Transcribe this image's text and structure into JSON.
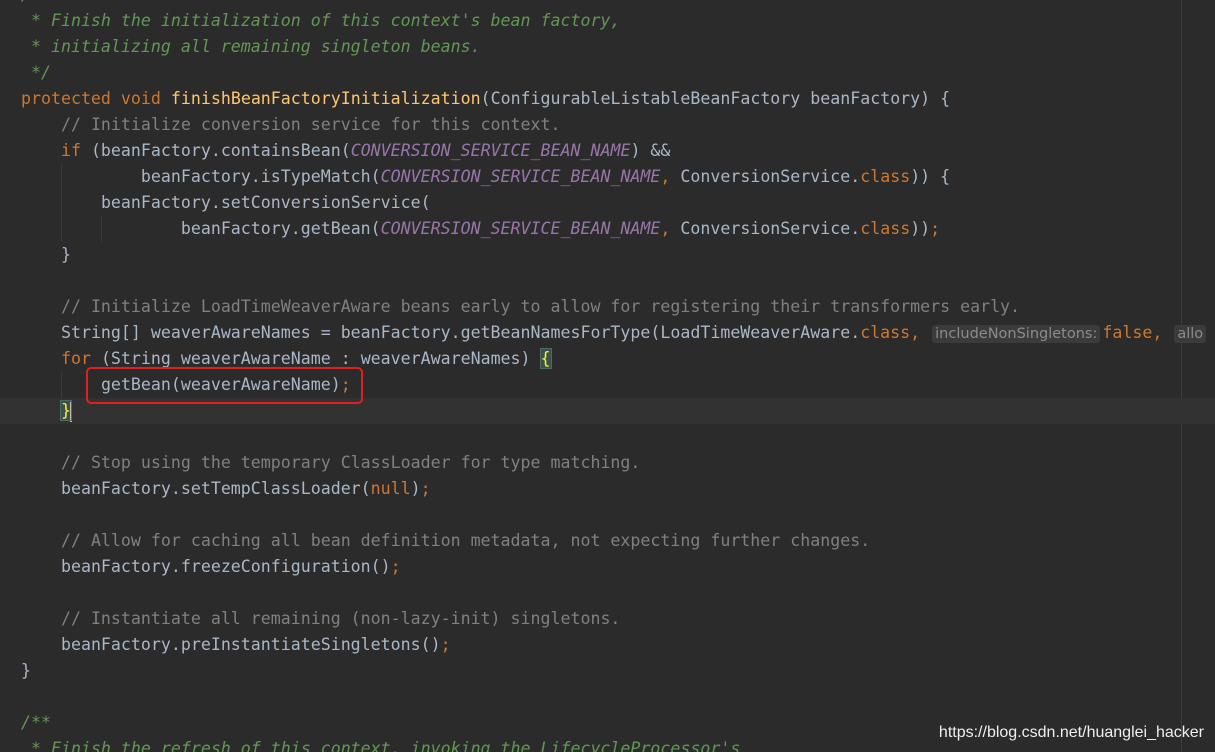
{
  "editor": {
    "lines": {
      "l0": "/",
      "l1": " * Finish the initialization of this context's bean factory,",
      "l2": " * initializing all remaining singleton beans.",
      "l3": " */",
      "l4_kw1": "protected",
      "l4_kw2": "void",
      "l4_fn": "finishBeanFactoryInitialization",
      "l4_rest": "(ConfigurableListableBeanFactory beanFactory) {",
      "l5": "// Initialize conversion service for this context.",
      "l6_kw": "if",
      "l6_a": " (beanFactory.containsBean(",
      "l6_const": "CONVERSION_SERVICE_BEAN_NAME",
      "l6_b": ") &&",
      "l7_a": "beanFactory.isTypeMatch(",
      "l7_const": "CONVERSION_SERVICE_BEAN_NAME",
      "l7_comma": ",",
      "l7_b": " ConversionService.",
      "l7_kw": "class",
      "l7_c": ")) {",
      "l8": "beanFactory.setConversionService(",
      "l9_a": "beanFactory.getBean(",
      "l9_const": "CONVERSION_SERVICE_BEAN_NAME",
      "l9_comma": ",",
      "l9_b": " ConversionService.",
      "l9_kw": "class",
      "l9_c": "))",
      "l9_semi": ";",
      "l10": "}",
      "l12": "// Initialize LoadTimeWeaverAware beans early to allow for registering their transformers early.",
      "l13_a": "String[] weaverAwareNames = beanFactory.getBeanNamesForType(LoadTimeWeaverAware.",
      "l13_kw": "class",
      "l13_comma": ",",
      "l13_hint1": "includeNonSingletons:",
      "l13_false": "false",
      "l13_comma2": ",",
      "l13_hint2": "allo",
      "l14_kw": "for",
      "l14_a": " (String weaverAwareName : weaverAwareNames) ",
      "l14_brace": "{",
      "l15_a": "getBean(weaverAwareName)",
      "l15_semi": ";",
      "l16_brace": "}",
      "l18": "// Stop using the temporary ClassLoader for type matching.",
      "l19_a": "beanFactory.setTempClassLoader(",
      "l19_kw": "null",
      "l19_b": ")",
      "l19_semi": ";",
      "l21": "// Allow for caching all bean definition metadata, not expecting further changes.",
      "l22_a": "beanFactory.freezeConfiguration()",
      "l22_semi": ";",
      "l24": "// Instantiate all remaining (non-lazy-init) singletons.",
      "l25_a": "beanFactory.preInstantiateSingletons()",
      "l25_semi": ";",
      "l26": "}",
      "l28": "/**",
      "l29": " * Finish the refresh of this context, invoking the LifecycleProcessor's"
    }
  },
  "watermark": "https://blog.csdn.net/huanglei_hacker",
  "colors": {
    "background": "#2b2b2b",
    "keyword": "#cc7832",
    "function": "#ffc66d",
    "constant": "#9876aa",
    "comment": "#808080",
    "doc_comment": "#629755",
    "text": "#a9b7c6",
    "annotation_box": "#e02020"
  }
}
